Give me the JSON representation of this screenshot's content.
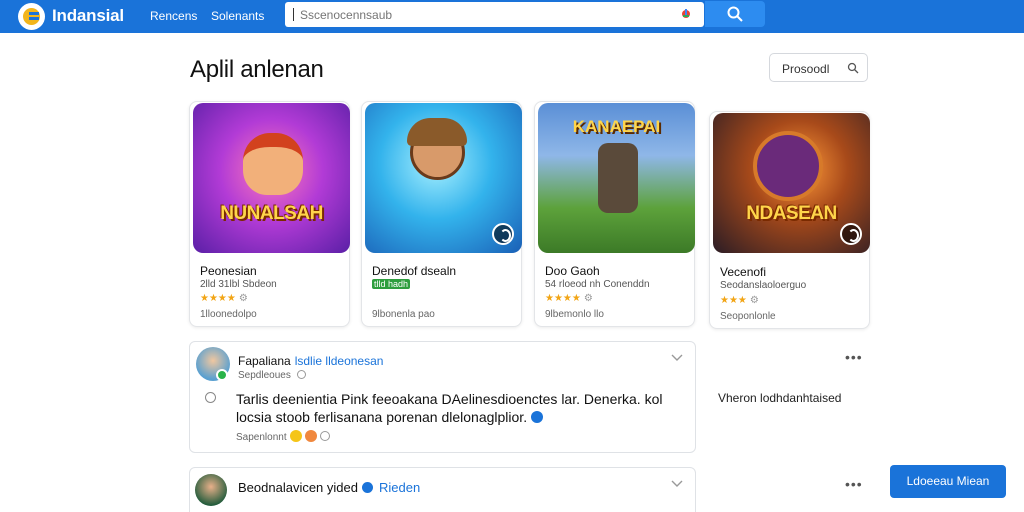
{
  "header": {
    "brand": "Indansial",
    "nav": [
      "Rencens",
      "Solenants"
    ],
    "search_placeholder": "Sscenocennsaub"
  },
  "page": {
    "title": "Aplil anlenan",
    "filter_label": "Prosoodl"
  },
  "apps": [
    {
      "thumb_title": "NUNALSAH",
      "name": "Peonesian",
      "sub": "2lld 31lbl Sbdeon",
      "stars": "★★★★",
      "meta": "1lloonedolpo"
    },
    {
      "thumb_title": "",
      "name": "Denedof dsealn",
      "sub": "tlld hadh",
      "stars": "",
      "meta": "9lbonenla pao"
    },
    {
      "thumb_title": "KANAEPAI",
      "name": "Doo Gaoh",
      "sub": "54 rloeod nh Conenddn",
      "stars": "★★★★",
      "meta": "9lbemonlo llo"
    },
    {
      "thumb_title": "NDASEAN",
      "name": "Vecenofi",
      "sub": "Seodanslaoloerguo",
      "stars": "★★★",
      "meta": "Seoponlonle"
    }
  ],
  "posts": [
    {
      "author": "Fapaliana",
      "tag": "lsdlie lldeonesan",
      "time": "Sepdleoues",
      "body": "Tarlis deenientia Pink feeoakana DAelinesdioenctes lar. Denerka. kol locsia stoob ferlisanana porenan dlelonaglplior.",
      "footer": "Sapenlonnt"
    },
    {
      "author": "Beodnalavicen yided",
      "tag": "Rieden"
    }
  ],
  "sidebar": {
    "text": "Vheron lodhdanhtaised",
    "cta_label": "Ldoeeau Miean"
  },
  "colors": {
    "header_bg": "#1a73d9",
    "accent": "#2d8cf0",
    "star": "#f2a516"
  }
}
